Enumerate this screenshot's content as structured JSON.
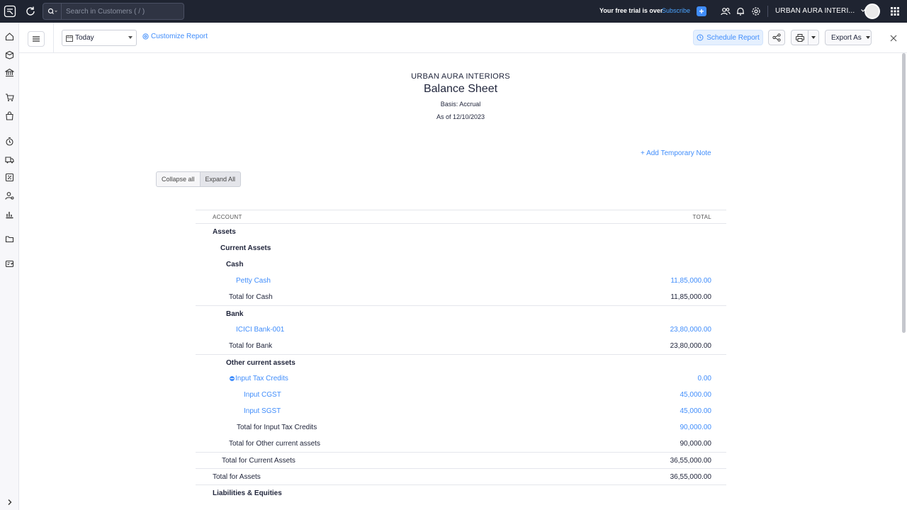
{
  "topbar": {
    "search_placeholder": "Search in Customers ( / )",
    "trial_text": "Your free trial is over",
    "subscribe_label": "Subscribe",
    "plus_label": "+",
    "org_label": "URBAN AURA INTERI..."
  },
  "toolbar": {
    "date_value": "Today",
    "customize_label": "Customize Report",
    "schedule_label": "Schedule Report",
    "export_label": "Export As"
  },
  "report": {
    "org_name": "URBAN AURA INTERIORS",
    "title": "Balance Sheet",
    "basis": "Basis: Accrual",
    "as_of": "As of 12/10/2023",
    "temp_note_label": "+ Add Temporary Note",
    "collapse_label": "Collapse all",
    "expand_label": "Expand All",
    "col_account": "ACCOUNT",
    "col_total": "TOTAL",
    "rows": [
      {
        "label": "Assets",
        "value": ""
      },
      {
        "label": "Current Assets",
        "value": ""
      },
      {
        "label": "Cash",
        "value": ""
      },
      {
        "label": "Petty Cash",
        "value": "11,85,000.00"
      },
      {
        "label": "Total for Cash",
        "value": "11,85,000.00"
      },
      {
        "label": "Bank",
        "value": ""
      },
      {
        "label": "ICICI Bank-001",
        "value": "23,80,000.00"
      },
      {
        "label": "Total for Bank",
        "value": "23,80,000.00"
      },
      {
        "label": "Other current assets",
        "value": ""
      },
      {
        "label": "Input Tax Credits",
        "value": "0.00"
      },
      {
        "label": "Input CGST",
        "value": "45,000.00"
      },
      {
        "label": "Input SGST",
        "value": "45,000.00"
      },
      {
        "label": "Total for Input Tax Credits",
        "value": "90,000.00"
      },
      {
        "label": "Total for Other current assets",
        "value": "90,000.00"
      },
      {
        "label": "Total for Current Assets",
        "value": "36,55,000.00"
      },
      {
        "label": "Total for Assets",
        "value": "36,55,000.00"
      },
      {
        "label": "Liabilities & Equities",
        "value": ""
      }
    ]
  },
  "colors": {
    "topbar_bg": "#1f2431",
    "accent": "#408dfb",
    "text": "#21263c"
  }
}
